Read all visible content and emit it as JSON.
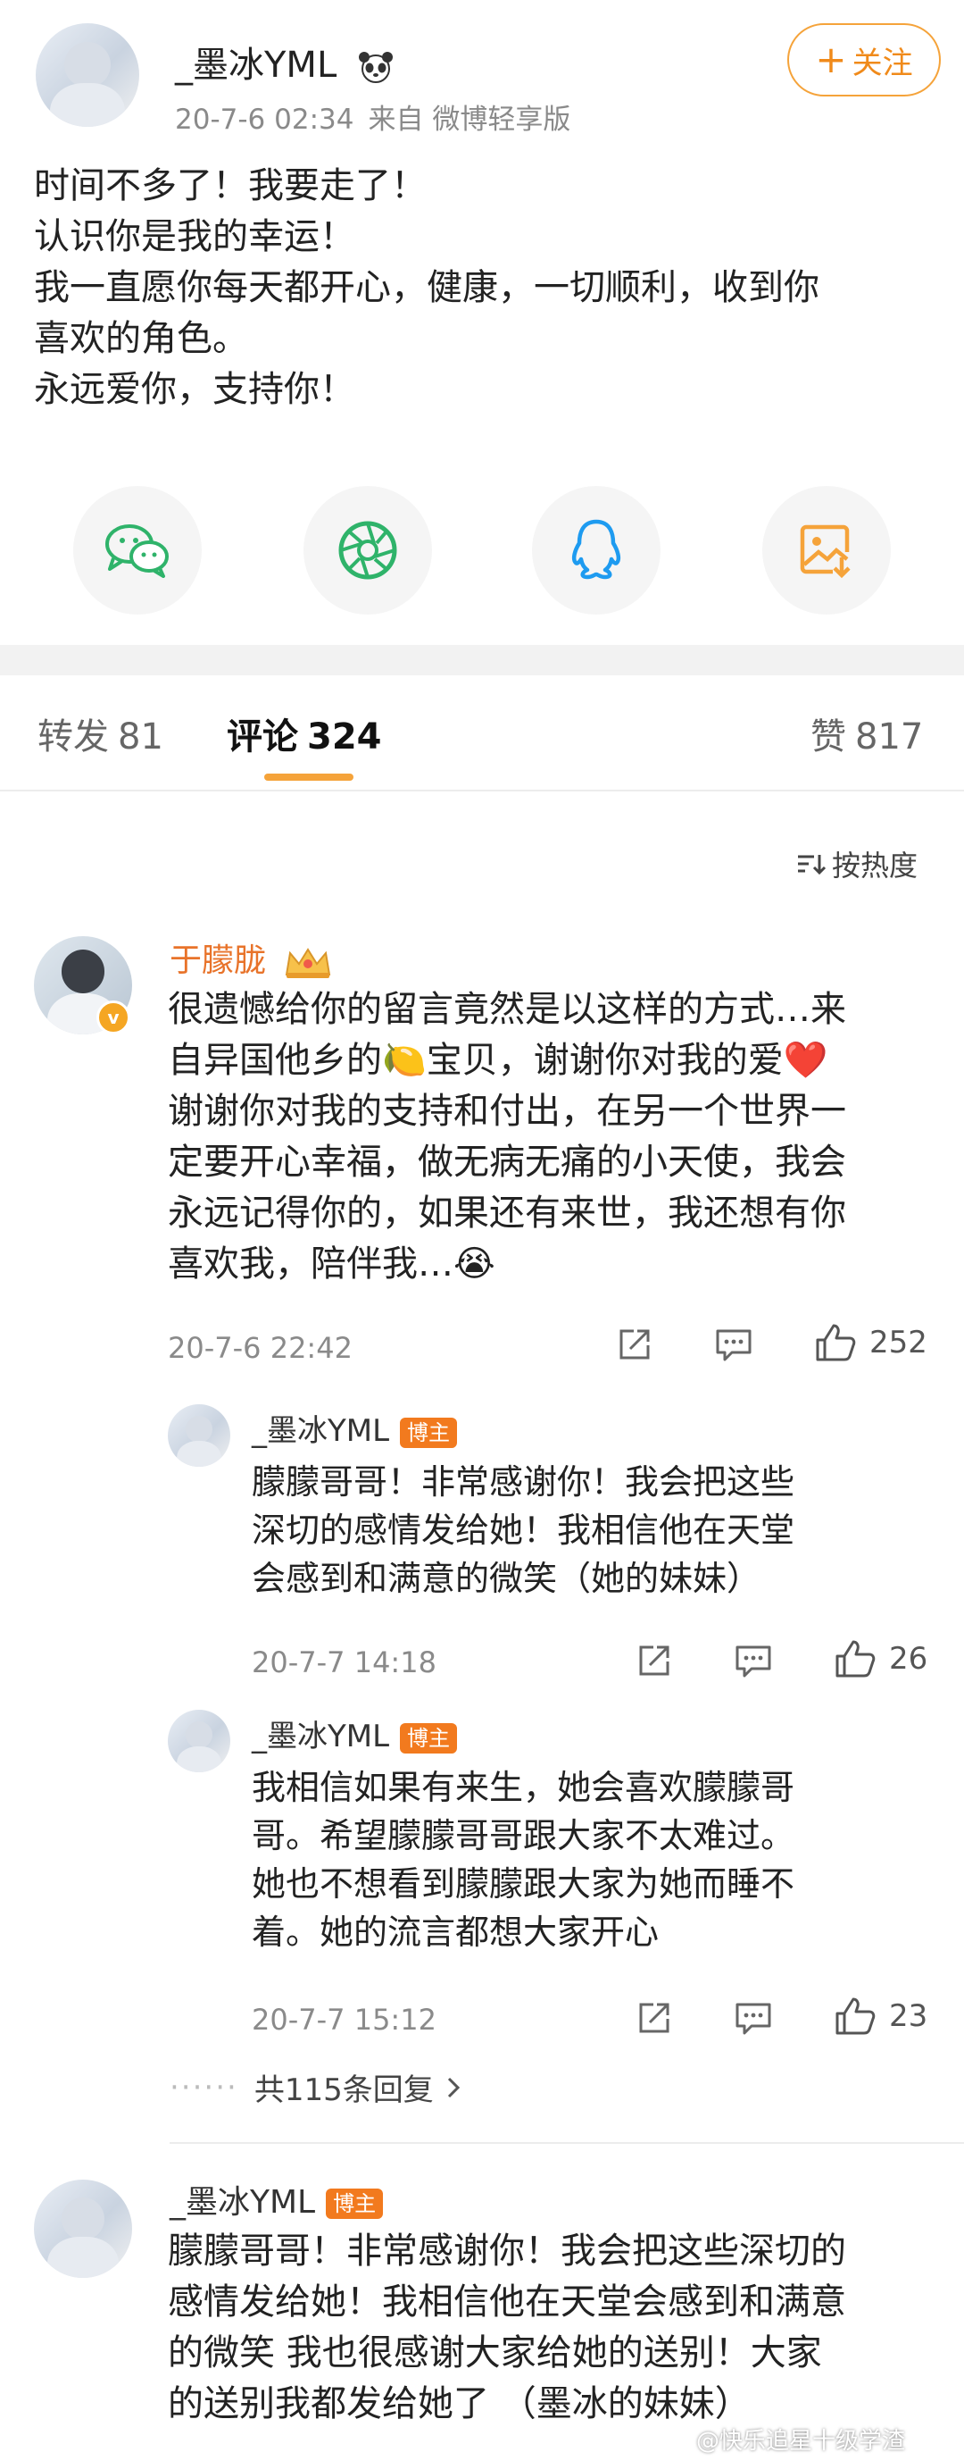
{
  "post": {
    "author": "_墨冰YML",
    "time": "20-7-6 02:34",
    "source": "来自 微博轻享版",
    "follow_label": "关注",
    "lines": [
      "时间不多了！我要走了！",
      "认识你是我的幸运！",
      "我一直愿你每天都开心，健康，一切顺利，收到你",
      "喜欢的角色。",
      "永远爱你，支持你！"
    ]
  },
  "share": {
    "items": [
      {
        "icon": "wechat-icon",
        "color": "#2fb36a"
      },
      {
        "icon": "moments-icon",
        "color": "#2fb36a"
      },
      {
        "icon": "qq-icon",
        "color": "#1e9bf0"
      },
      {
        "icon": "save-image-icon",
        "color": "#f5a33a"
      }
    ]
  },
  "tabs": {
    "repost_label": "转发",
    "repost_count": "81",
    "comment_label": "评论",
    "comment_count": "324",
    "like_label": "赞",
    "like_count": "817",
    "accent": "#f5a33a"
  },
  "sort_label": "按热度",
  "comments": [
    {
      "author": "于朦胧",
      "lines": [
        "很遗憾给你的留言竟然是以这样的方式…来",
        "自异国他乡的🍋宝贝，谢谢你对我的爱❤️",
        "谢谢你对我的支持和付出，在另一个世界一",
        "定要开心幸福，做无病无痛的小天使，我会",
        "永远记得你的，如果还有来世，我还想有你",
        "喜欢我，陪伴我…😭"
      ],
      "time": "20-7-6 22:42",
      "likes": "252",
      "replies": [
        {
          "author": "_墨冰YML",
          "badge": "博主",
          "lines": [
            "朦朦哥哥！非常感谢你！我会把这些",
            "深切的感情发给她！我相信他在天堂",
            "会感到和满意的微笑（她的妹妹）"
          ],
          "time": "20-7-7 14:18",
          "likes": "26"
        },
        {
          "author": "_墨冰YML",
          "badge": "博主",
          "lines": [
            "我相信如果有来生，她会喜欢朦朦哥",
            "哥。希望朦朦哥哥跟大家不太难过。",
            "她也不想看到朦朦跟大家为她而睡不",
            "着。她的流言都想大家开心"
          ],
          "time": "20-7-7 15:12",
          "likes": "23"
        }
      ],
      "more_replies": "共115条回复"
    },
    {
      "author": "_墨冰YML",
      "badge": "博主",
      "lines": [
        "朦朦哥哥！非常感谢你！我会把这些深切的",
        "感情发给她！我相信他在天堂会感到和满意",
        "的微笑 我也很感谢大家给她的送别！大家",
        "的送别我都发给她了 （墨冰的妹妹）"
      ]
    }
  ],
  "watermark": "@快乐追星十级学渣"
}
